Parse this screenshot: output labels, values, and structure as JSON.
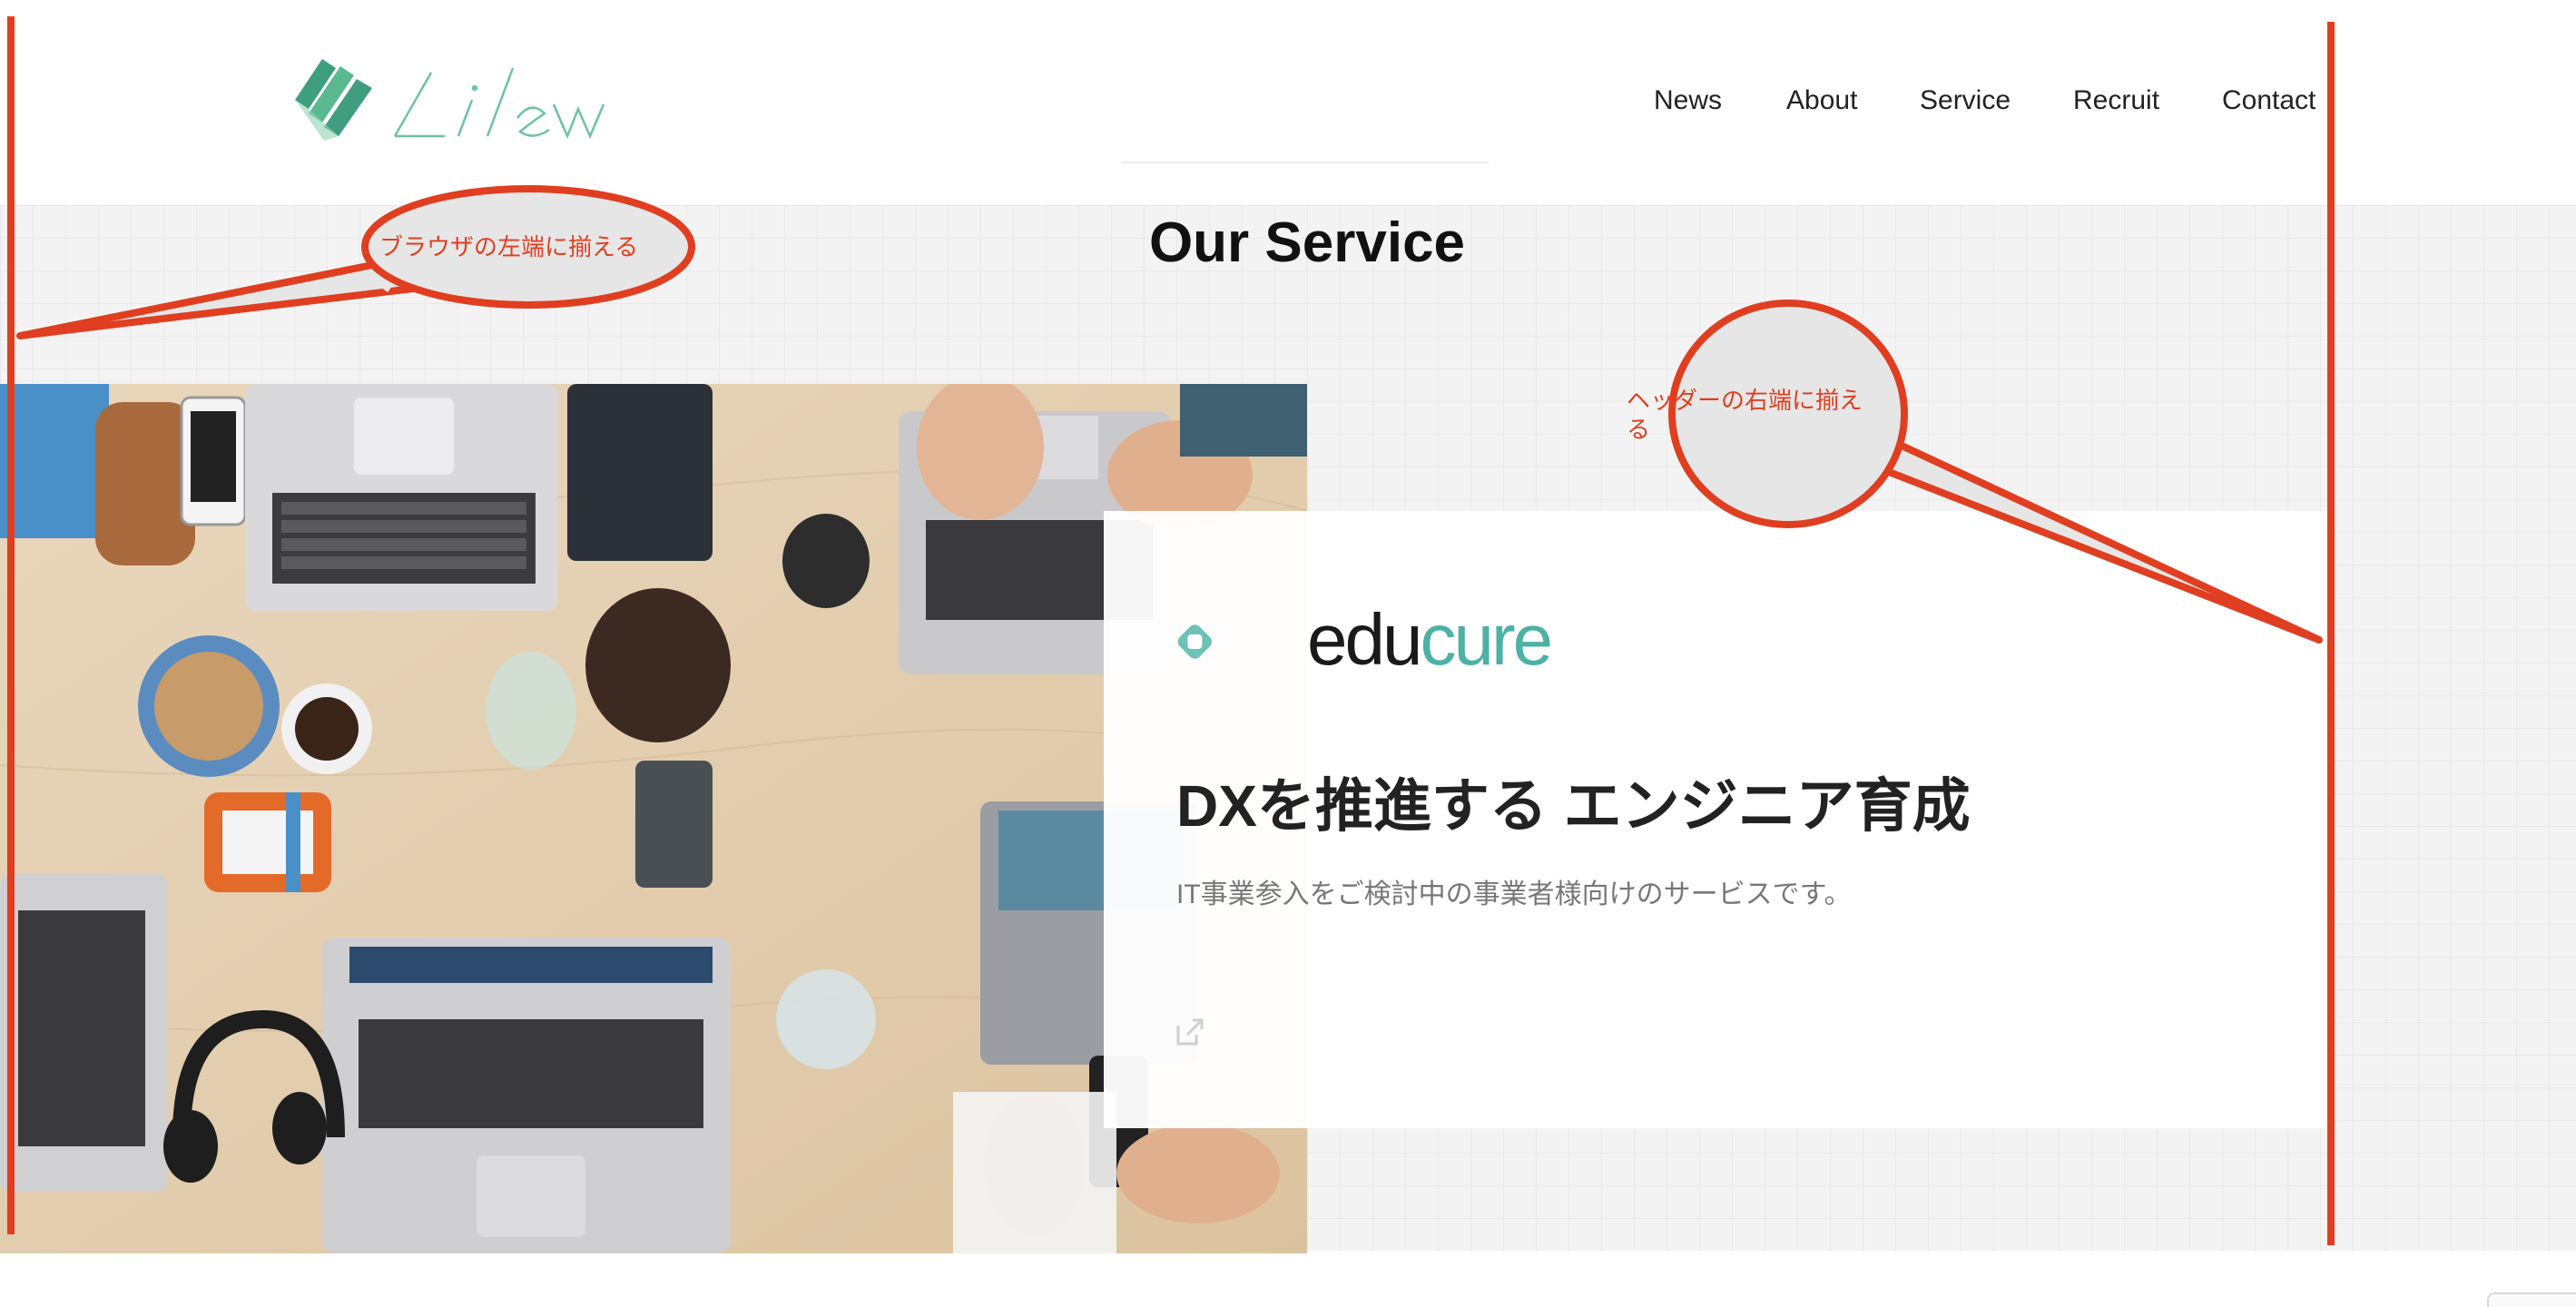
{
  "header": {
    "logo_alt": "Lilew logo",
    "nav": [
      {
        "label": "News"
      },
      {
        "label": "About"
      },
      {
        "label": "Service"
      },
      {
        "label": "Recruit"
      },
      {
        "label": "Contact"
      }
    ]
  },
  "section": {
    "title": "Our Service"
  },
  "service_card": {
    "logo_text_a": "edu",
    "logo_text_b": "cure",
    "title": "DXを推進する エンジニア育成",
    "description": "IT事業参入をご検討中の事業者様向けのサービスです。",
    "link_icon": "external-link-icon"
  },
  "annotations": {
    "left_callout": "ブラウザの左端に揃える",
    "right_callout": "ヘッダーの右端に揃える",
    "color": "#e03e20"
  },
  "colors": {
    "brand_teal": "#4db1a5",
    "logo_green": "#3f9e7e",
    "annotation_red": "#e03e20"
  }
}
